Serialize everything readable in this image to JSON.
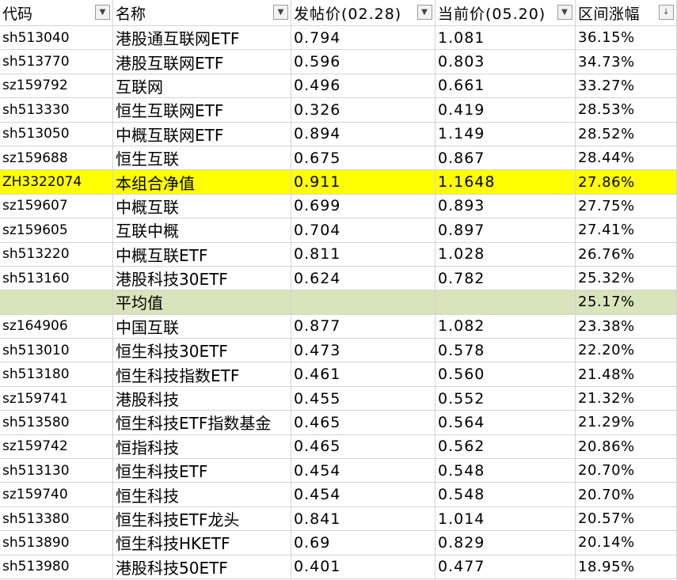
{
  "header": {
    "columns": [
      "代码",
      "名称",
      "发帖价(02.28)",
      "当前价(05.20)",
      "区间涨幅"
    ],
    "filter_icons": [
      "▼",
      "▼",
      "▼",
      "▼",
      "↓"
    ]
  },
  "rows": [
    {
      "code": "sh513040",
      "name": "港股通互联网ETF",
      "post": "0.794",
      "cur": "1.081",
      "chg": "36.15%",
      "style": ""
    },
    {
      "code": "sh513770",
      "name": "港股互联网ETF",
      "post": "0.596",
      "cur": "0.803",
      "chg": "34.73%",
      "style": ""
    },
    {
      "code": "sz159792",
      "name": "互联网",
      "post": "0.496",
      "cur": "0.661",
      "chg": "33.27%",
      "style": ""
    },
    {
      "code": "sh513330",
      "name": "恒生互联网ETF",
      "post": "0.326",
      "cur": "0.419",
      "chg": "28.53%",
      "style": ""
    },
    {
      "code": "sh513050",
      "name": "中概互联网ETF",
      "post": "0.894",
      "cur": "1.149",
      "chg": "28.52%",
      "style": ""
    },
    {
      "code": "sz159688",
      "name": "恒生互联",
      "post": "0.675",
      "cur": "0.867",
      "chg": "28.44%",
      "style": ""
    },
    {
      "code": "ZH3322074",
      "name": "本组合净值",
      "post": "0.911",
      "cur": "1.1648",
      "chg": "27.86%",
      "style": "highlight-yellow"
    },
    {
      "code": "sz159607",
      "name": "中概互联",
      "post": "0.699",
      "cur": "0.893",
      "chg": "27.75%",
      "style": ""
    },
    {
      "code": "sz159605",
      "name": "互联中概",
      "post": "0.704",
      "cur": "0.897",
      "chg": "27.41%",
      "style": ""
    },
    {
      "code": "sh513220",
      "name": "中概互联ETF",
      "post": "0.811",
      "cur": "1.028",
      "chg": "26.76%",
      "style": ""
    },
    {
      "code": "sh513160",
      "name": "港股科技30ETF",
      "post": "0.624",
      "cur": "0.782",
      "chg": "25.32%",
      "style": ""
    },
    {
      "code": "",
      "name": "平均值",
      "post": "",
      "cur": "",
      "chg": "25.17%",
      "style": "highlight-green"
    },
    {
      "code": "sz164906",
      "name": "中国互联",
      "post": "0.877",
      "cur": "1.082",
      "chg": "23.38%",
      "style": ""
    },
    {
      "code": "sh513010",
      "name": "恒生科技30ETF",
      "post": "0.473",
      "cur": "0.578",
      "chg": "22.20%",
      "style": ""
    },
    {
      "code": "sh513180",
      "name": "恒生科技指数ETF",
      "post": "0.461",
      "cur": "0.560",
      "chg": "21.48%",
      "style": ""
    },
    {
      "code": "sz159741",
      "name": "港股科技",
      "post": "0.455",
      "cur": "0.552",
      "chg": "21.32%",
      "style": ""
    },
    {
      "code": "sh513580",
      "name": "恒生科技ETF指数基金",
      "post": "0.465",
      "cur": "0.564",
      "chg": "21.29%",
      "style": ""
    },
    {
      "code": "sz159742",
      "name": "恒指科技",
      "post": "0.465",
      "cur": "0.562",
      "chg": "20.86%",
      "style": ""
    },
    {
      "code": "sh513130",
      "name": "恒生科技ETF",
      "post": "0.454",
      "cur": "0.548",
      "chg": "20.70%",
      "style": ""
    },
    {
      "code": "sz159740",
      "name": "恒生科技",
      "post": "0.454",
      "cur": "0.548",
      "chg": "20.70%",
      "style": ""
    },
    {
      "code": "sh513380",
      "name": "恒生科技ETF龙头",
      "post": "0.841",
      "cur": "1.014",
      "chg": "20.57%",
      "style": ""
    },
    {
      "code": "sh513890",
      "name": "恒生科技HKETF",
      "post": "0.69",
      "cur": "0.829",
      "chg": "20.14%",
      "style": ""
    },
    {
      "code": "sh513980",
      "name": "港股科技50ETF",
      "post": "0.401",
      "cur": "0.477",
      "chg": "18.95%",
      "style": ""
    }
  ]
}
